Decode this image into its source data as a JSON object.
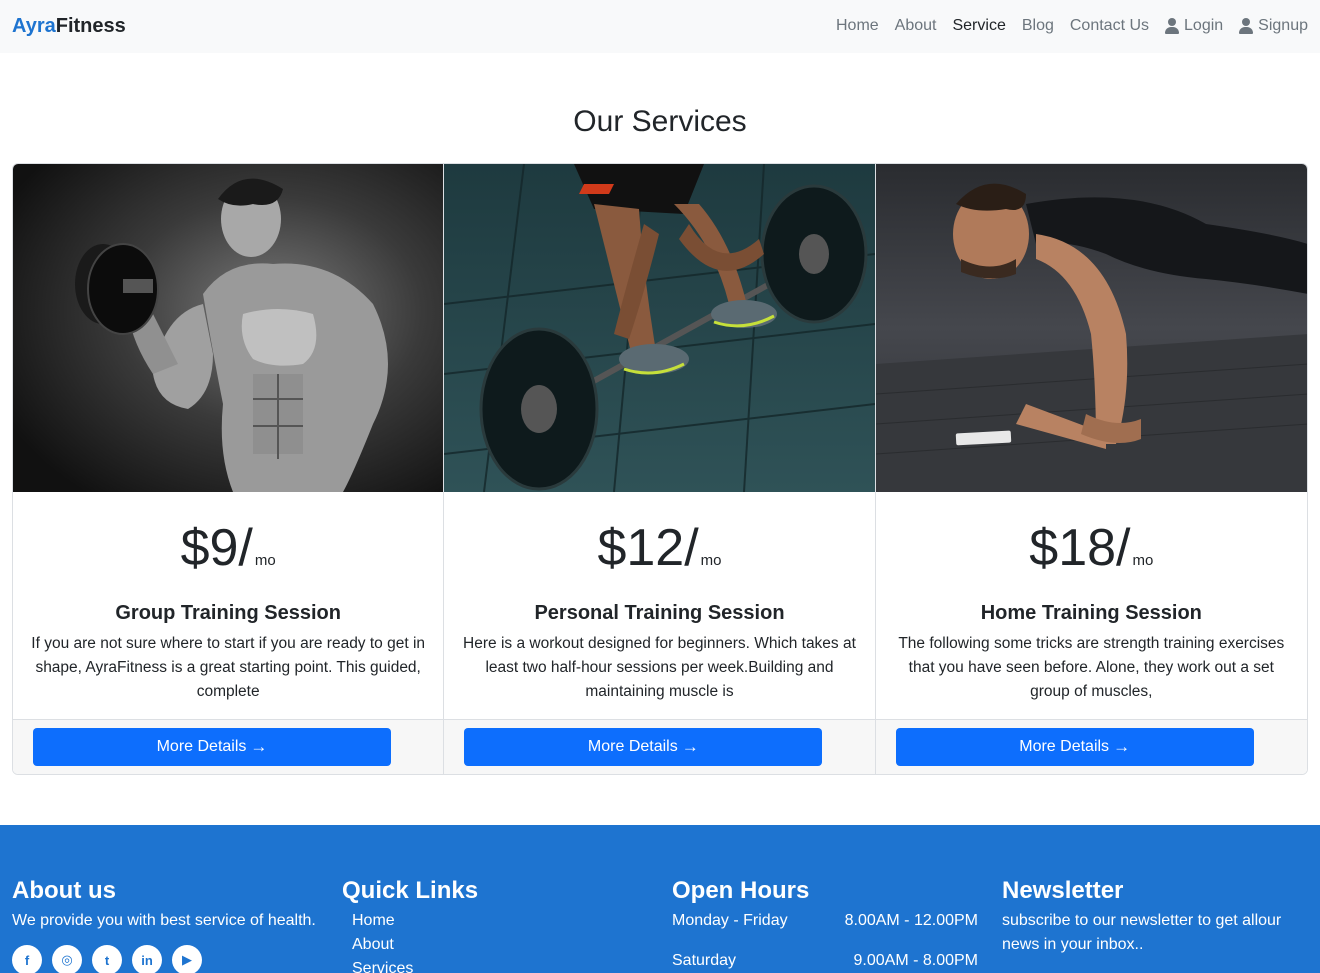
{
  "navbar": {
    "brand_part1": "Ayra",
    "brand_part2": "Fitness",
    "links": [
      {
        "label": "Home"
      },
      {
        "label": "About"
      },
      {
        "label": "Service"
      },
      {
        "label": "Blog"
      },
      {
        "label": "Contact Us"
      },
      {
        "label": "Login"
      },
      {
        "label": "Signup"
      }
    ],
    "active": "Service"
  },
  "section_title": "Our Services",
  "cards": [
    {
      "price": "$9/",
      "per": "mo",
      "title": "Group Training Session",
      "text": "If you are not sure where to start if you are ready to get in shape, AyraFitness is a great starting point. This guided, complete",
      "button": "More Details",
      "image": "man lifting dumbbell (black and white)"
    },
    {
      "price": "$12/",
      "per": "mo",
      "title": "Personal Training Session",
      "text": "Here is a workout designed for beginners. Which takes at least two half-hour sessions per week.Building and maintaining muscle is",
      "button": "More Details",
      "image": "person deadlifting barbell"
    },
    {
      "price": "$18/",
      "per": "mo",
      "title": "Home Training Session",
      "text": "The following some tricks are strength training exercises that you have seen before. Alone, they work out a set group of muscles,",
      "button": "More Details",
      "image": "man doing push-ups"
    }
  ],
  "footer": {
    "about": {
      "heading": "About us",
      "text": "We provide you with best service of health.",
      "social": [
        "facebook-icon",
        "instagram-icon",
        "twitter-icon",
        "linkedin-icon",
        "youtube-icon"
      ]
    },
    "quick_links": {
      "heading": "Quick Links",
      "items": [
        "Home",
        "About",
        "Services"
      ]
    },
    "open_hours": {
      "heading": "Open Hours",
      "rows": [
        {
          "day": "Monday - Friday",
          "time": "8.00AM - 12.00PM"
        },
        {
          "day": "Saturday",
          "time": "9.00AM - 8.00PM"
        }
      ]
    },
    "newsletter": {
      "heading": "Newsletter",
      "text": "subscribe to our newsletter to get allour news in your inbox.."
    }
  },
  "colors": {
    "brand": "#1e74d0",
    "button": "#0d6efd",
    "navbar_bg": "#f8f9fa",
    "footer_bg": "#1e74d0"
  }
}
